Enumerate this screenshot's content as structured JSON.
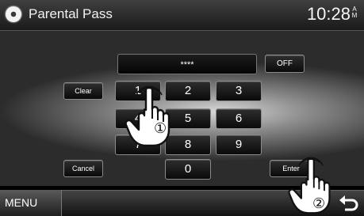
{
  "header": {
    "title": "Parental Pass",
    "time": "10:28",
    "ampm_top": "A",
    "ampm_bottom": "M",
    "disc_icon": "disc-icon"
  },
  "passcode": {
    "display": "****"
  },
  "buttons": {
    "off": "OFF",
    "clear": "Clear",
    "cancel": "Cancel",
    "enter": "Enter",
    "digits": [
      "1",
      "2",
      "3",
      "4",
      "5",
      "6",
      "7",
      "8",
      "9",
      "0"
    ]
  },
  "bottom": {
    "menu": "MENU",
    "return_icon": "return-icon"
  },
  "annotations": {
    "step1": "①",
    "step2": "②"
  },
  "colors": {
    "key_border": "#8a8a8a",
    "panel_glow": "#d8d8d8"
  }
}
